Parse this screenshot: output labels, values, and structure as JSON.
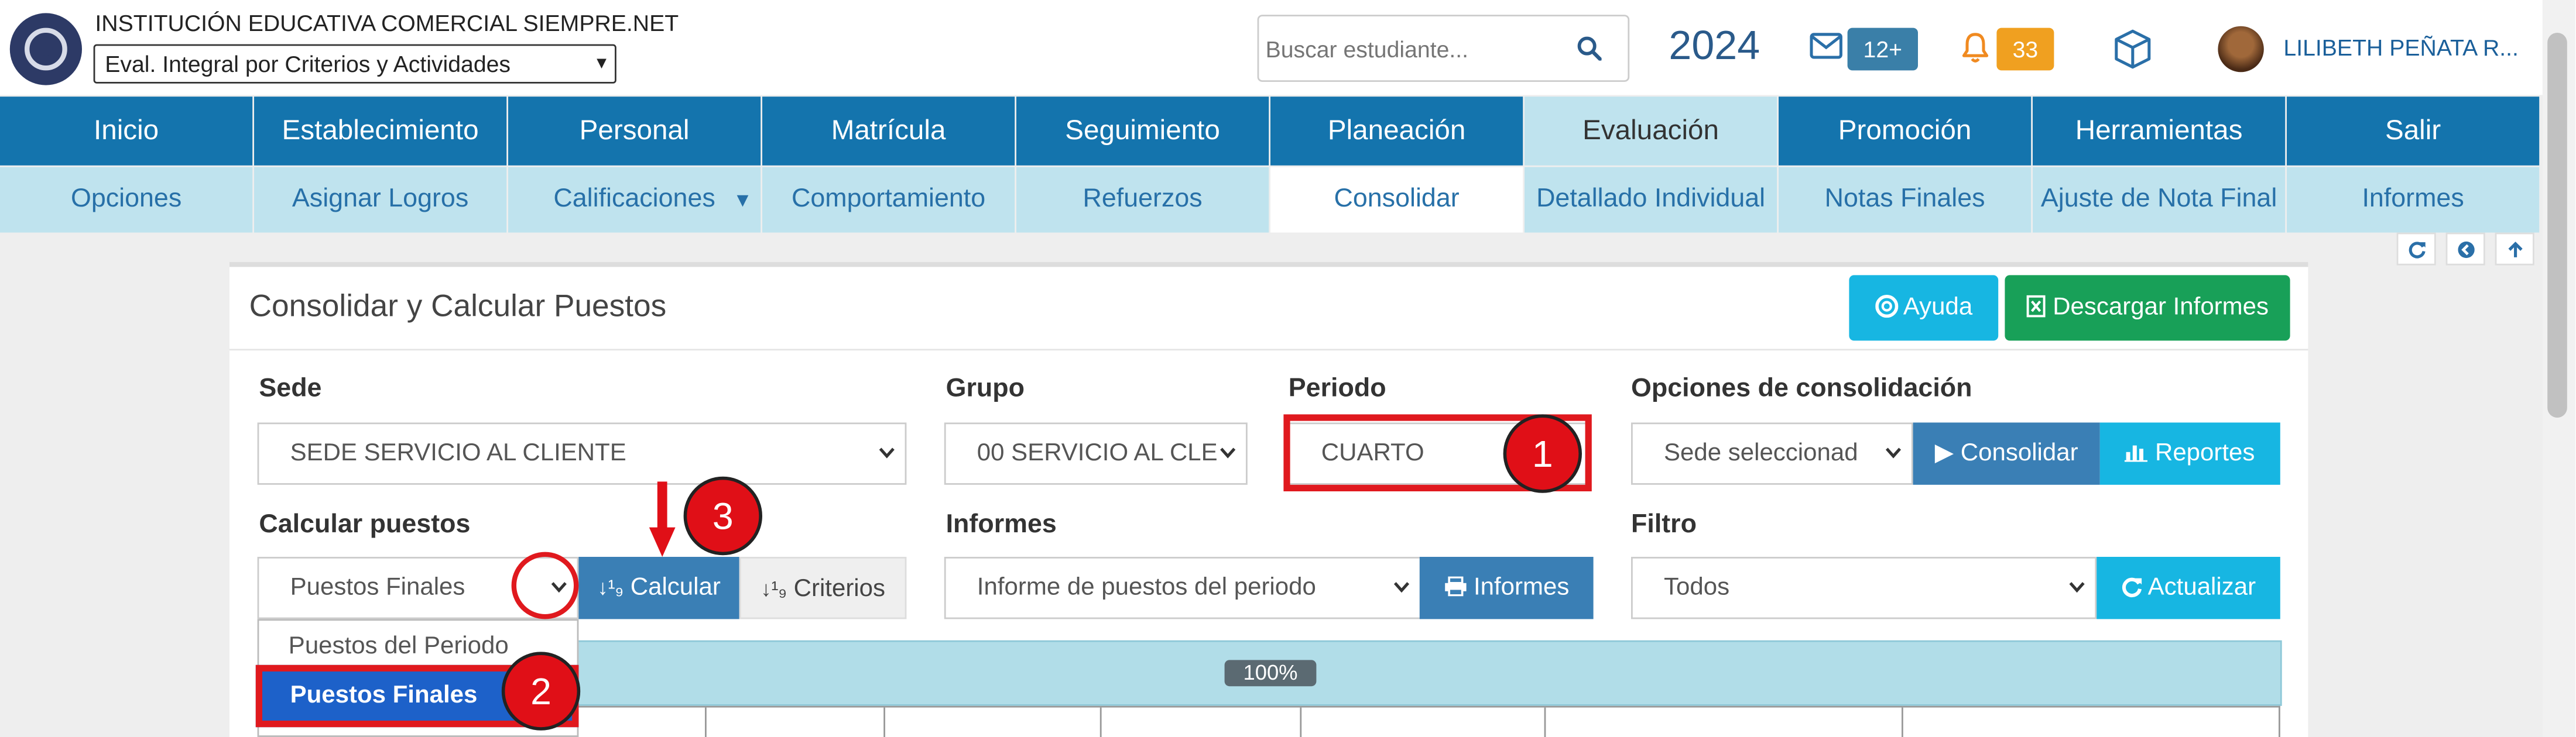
{
  "header": {
    "institution": "INSTITUCIÓN EDUCATIVA COMERCIAL SIEMPRE.NET",
    "eval_selector": "Eval. Integral por Criterios y Actividades",
    "search_placeholder": "Buscar estudiante...",
    "year": "2024",
    "messages_badge": "12+",
    "notifications_badge": "33",
    "user_name": "LILIBETH PEÑATA R...",
    "icons": [
      "search-icon",
      "mail-icon",
      "bell-icon",
      "cube-icon"
    ]
  },
  "menu": {
    "main": [
      "Inicio",
      "Establecimiento",
      "Personal",
      "Matrícula",
      "Seguimiento",
      "Planeación",
      "Evaluación",
      "Promoción",
      "Herramientas",
      "Salir"
    ],
    "active_main": "Evaluación",
    "sub": [
      "Opciones",
      "Asignar Logros",
      "Calificaciones",
      "Comportamiento",
      "Refuerzos",
      "Consolidar",
      "Detallado Individual",
      "Notas Finales",
      "Ajuste de Nota Final",
      "Informes"
    ],
    "active_sub": "Consolidar"
  },
  "panel": {
    "title": "Consolidar y Calcular Puestos",
    "help_button": "Ayuda",
    "download_button": "Descargar Informes",
    "sede": {
      "label": "Sede",
      "value": "SEDE SERVICIO AL CLIENTE"
    },
    "grupo": {
      "label": "Grupo",
      "value": "00 SERVICIO AL CLE"
    },
    "periodo": {
      "label": "Periodo",
      "value": "CUARTO"
    },
    "consolidacion": {
      "label": "Opciones de consolidación",
      "value": "Sede seleccionad",
      "consolidar_button": "Consolidar",
      "reportes_button": "Reportes"
    },
    "calcular": {
      "label": "Calcular puestos",
      "value": "Puestos Finales",
      "calcular_button": "Calcular",
      "criterios_button": "Criterios"
    },
    "informes": {
      "label": "Informes",
      "value": "Informe de puestos del periodo",
      "informes_button": "Informes"
    },
    "filtro": {
      "label": "Filtro",
      "value": "Todos",
      "actualizar_button": "Actualizar"
    },
    "dropdown_options": [
      "Puestos del Periodo",
      "Puestos Finales"
    ],
    "progress": {
      "label": "100%",
      "value": 100
    }
  },
  "annotations": [
    "1",
    "2",
    "3"
  ],
  "colors": {
    "primary": "#1474ad",
    "submenu": "#bfe3ee",
    "accent_cyan": "#17b6e2",
    "success": "#18a058",
    "highlight_red": "#e0191e"
  }
}
